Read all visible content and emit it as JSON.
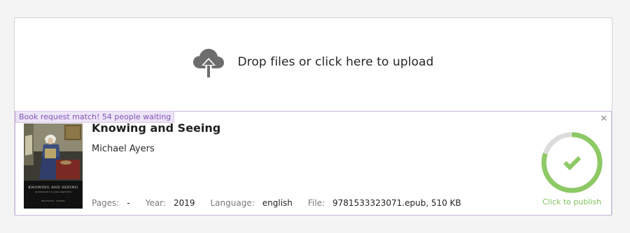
{
  "dropzone": {
    "text": "Drop files or click here to upload",
    "icon": "cloud-upload-icon"
  },
  "book": {
    "badge": "Book request match! 54 people waiting",
    "title": "Knowing and Seeing",
    "author": "Michael Ayers",
    "cover": {
      "title": "KNOWING AND SEEING",
      "subtitle": "groundwork for a new empiricism",
      "author": "MICHAEL AYERS"
    },
    "meta": [
      {
        "label": "Pages:",
        "value": "-"
      },
      {
        "label": "Year:",
        "value": "2019"
      },
      {
        "label": "Language:",
        "value": "english"
      },
      {
        "label": "File:",
        "value": "9781533323071.epub, 510 KB"
      }
    ],
    "close_icon": "close-icon",
    "publish": {
      "label": "Click to publish",
      "progress": 0.8,
      "icon": "checkmark-icon"
    }
  },
  "colors": {
    "accent_green": "#8dc965",
    "badge_purple": "#8257b8",
    "card_border": "#c9b6dd"
  }
}
